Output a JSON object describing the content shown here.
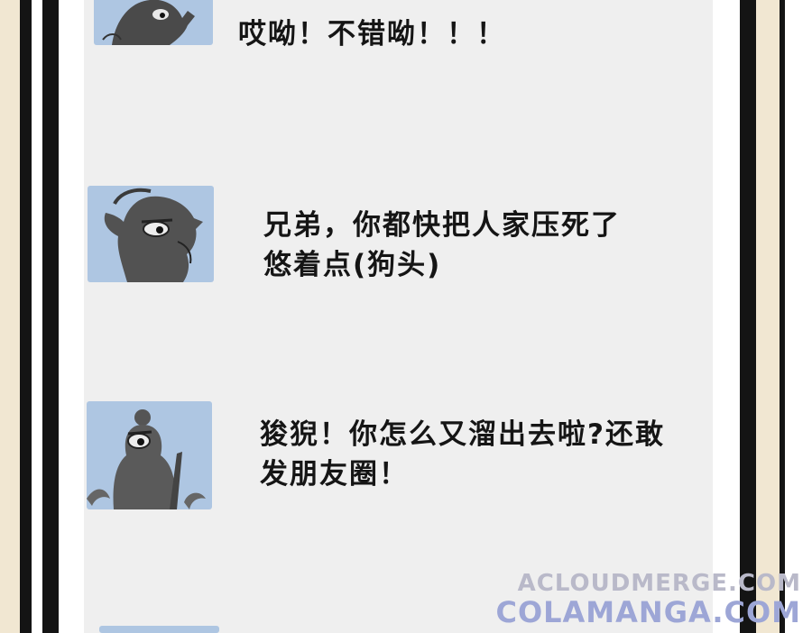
{
  "messages": [
    {
      "text_lines": [
        "哎呦！不错呦！！！"
      ],
      "avatar_icon": "dragon-statue-icon"
    },
    {
      "text_lines": [
        "兄弟，你都快把人家压死了",
        "悠着点(狗头)"
      ],
      "avatar_icon": "dragon-statue-icon"
    },
    {
      "text_lines": [
        "狻猊！你怎么又溜出去啦?还敢",
        "发朋友圈！"
      ],
      "avatar_icon": "immortal-statue-icon"
    }
  ],
  "watermark": {
    "line1": "ACLOUDMERGE.COM",
    "line2": "COLAMANGA.COM"
  },
  "colors": {
    "panel": "#efefef",
    "avatar_bg": "#aec6e2",
    "border_beige": "#f1e7d2",
    "border_black": "#141414",
    "text": "#151515"
  }
}
